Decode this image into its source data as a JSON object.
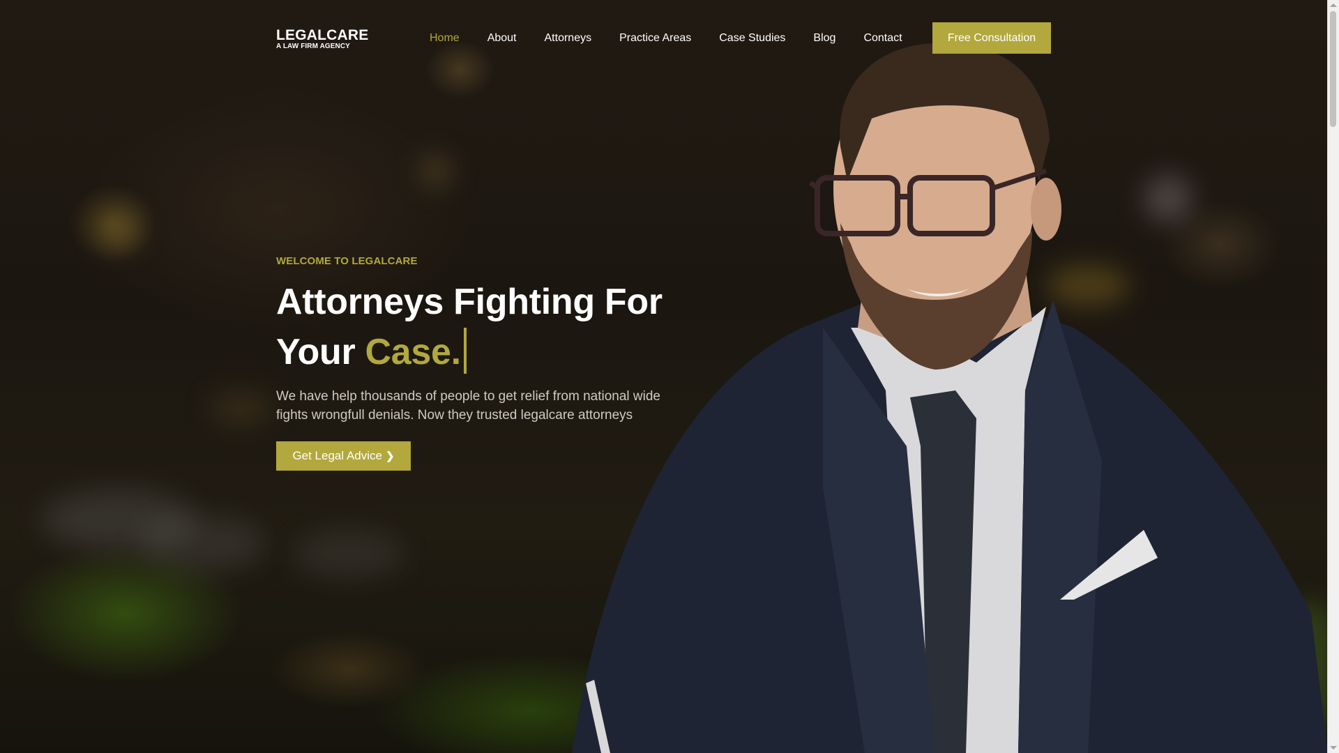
{
  "brand": {
    "name": "LEGALCARE",
    "tagline": "A LAW FIRM AGENCY",
    "accent_color": "#b2a83d"
  },
  "nav": {
    "items": [
      {
        "label": "Home",
        "active": true
      },
      {
        "label": "About",
        "active": false
      },
      {
        "label": "Attorneys",
        "active": false
      },
      {
        "label": "Practice Areas",
        "active": false
      },
      {
        "label": "Case Studies",
        "active": false
      },
      {
        "label": "Blog",
        "active": false
      },
      {
        "label": "Contact",
        "active": false
      }
    ],
    "cta_label": "Free Consultation"
  },
  "hero": {
    "eyebrow": "WELCOME TO LEGALCARE",
    "headline_line1": "Attorneys Fighting For",
    "headline_line2_prefix": "Your ",
    "headline_highlight": "Case.",
    "description": "We have help thousands of people to get relief from national wide fights wrongfull denials. Now they trusted legalcare attorneys",
    "button_label": "Get Legal Advice",
    "button_icon": "chevron-right-icon"
  }
}
